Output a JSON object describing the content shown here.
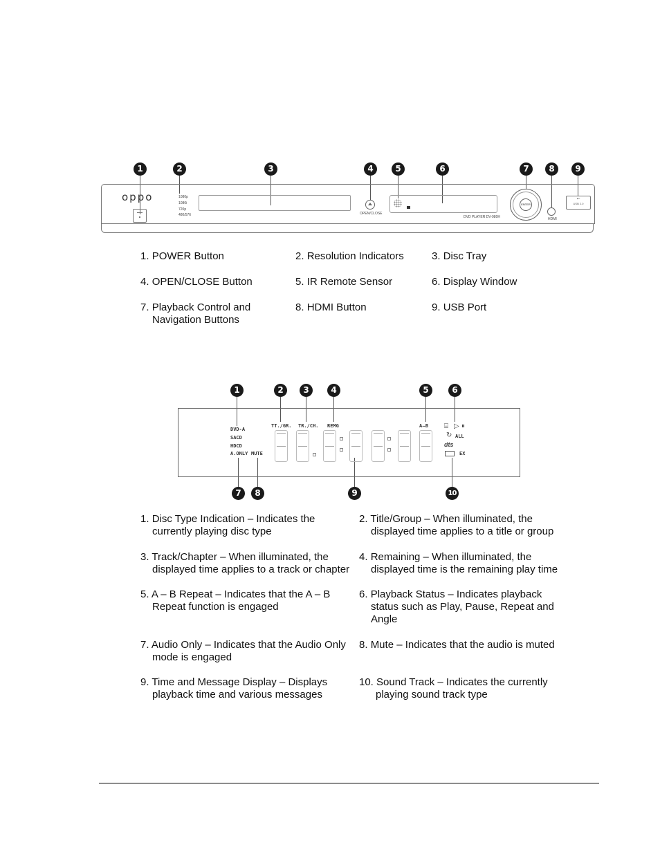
{
  "front_panel": {
    "brand_logo": "oppo",
    "resolution_labels": [
      "1080p",
      "1080i",
      "720p",
      "480/576"
    ],
    "open_close_label": "OPEN/CLOSE",
    "model_label": "DVD PLAYER DV-980H",
    "enter_label": "ENTER",
    "hdmi_label": "HDMI",
    "usb_label": "USB 2.0",
    "callouts": [
      "1",
      "2",
      "3",
      "4",
      "5",
      "6",
      "7",
      "8",
      "9"
    ],
    "items": [
      {
        "num": "1.",
        "text": "POWER Button"
      },
      {
        "num": "2.",
        "text": "Resolution Indicators"
      },
      {
        "num": "3.",
        "text": "Disc Tray"
      },
      {
        "num": "4.",
        "text": "OPEN/CLOSE Button"
      },
      {
        "num": "5.",
        "text": "IR Remote Sensor"
      },
      {
        "num": "6.",
        "text": "Display Window"
      },
      {
        "num": "7.",
        "text": "Playback Control and",
        "cont": "Navigation Buttons"
      },
      {
        "num": "8.",
        "text": "HDMI Button"
      },
      {
        "num": "9.",
        "text": "USB Port"
      }
    ]
  },
  "display": {
    "disc_types": [
      "DVD-A",
      "SACD",
      "HDCD"
    ],
    "audio_only": "A.ONLY",
    "mute": "MUTE",
    "title_group": "TT./GR.",
    "track_chapter": "TR./CH.",
    "remaining": "REMG",
    "ab_repeat": "A⌢B",
    "repeat_all": "ALL",
    "dts": "dts",
    "ex": "EX",
    "callouts": [
      "1",
      "2",
      "3",
      "4",
      "5",
      "6",
      "7",
      "8",
      "9",
      "10"
    ],
    "items": [
      {
        "num": "1.",
        "text": "Disc Type Indication – Indicates the",
        "cont": "currently playing disc type"
      },
      {
        "num": "2.",
        "text": "Title/Group – When illuminated, the",
        "cont": "displayed time applies to a title or group"
      },
      {
        "num": "3.",
        "text": "Track/Chapter – When illuminated, the",
        "cont": "displayed time applies to a track or chapter"
      },
      {
        "num": "4.",
        "text": "Remaining – When illuminated, the",
        "cont": "displayed time is the remaining play time"
      },
      {
        "num": "5.",
        "text": "A – B Repeat – Indicates that the A – B",
        "cont": "Repeat function is engaged"
      },
      {
        "num": "6.",
        "text": "Playback Status – Indicates playback",
        "cont": "status such as Play, Pause, Repeat and",
        "cont2": "Angle"
      },
      {
        "num": "7.",
        "text": "Audio Only – Indicates that the Audio Only",
        "cont": "mode is engaged"
      },
      {
        "num": "8.",
        "text": "Mute – Indicates that the audio is muted"
      },
      {
        "num": "9.",
        "text": "Time and Message Display – Displays",
        "cont": "playback time and various messages"
      },
      {
        "num": "10.",
        "text": "Sound Track – Indicates the currently",
        "cont": "playing sound track type"
      }
    ]
  }
}
